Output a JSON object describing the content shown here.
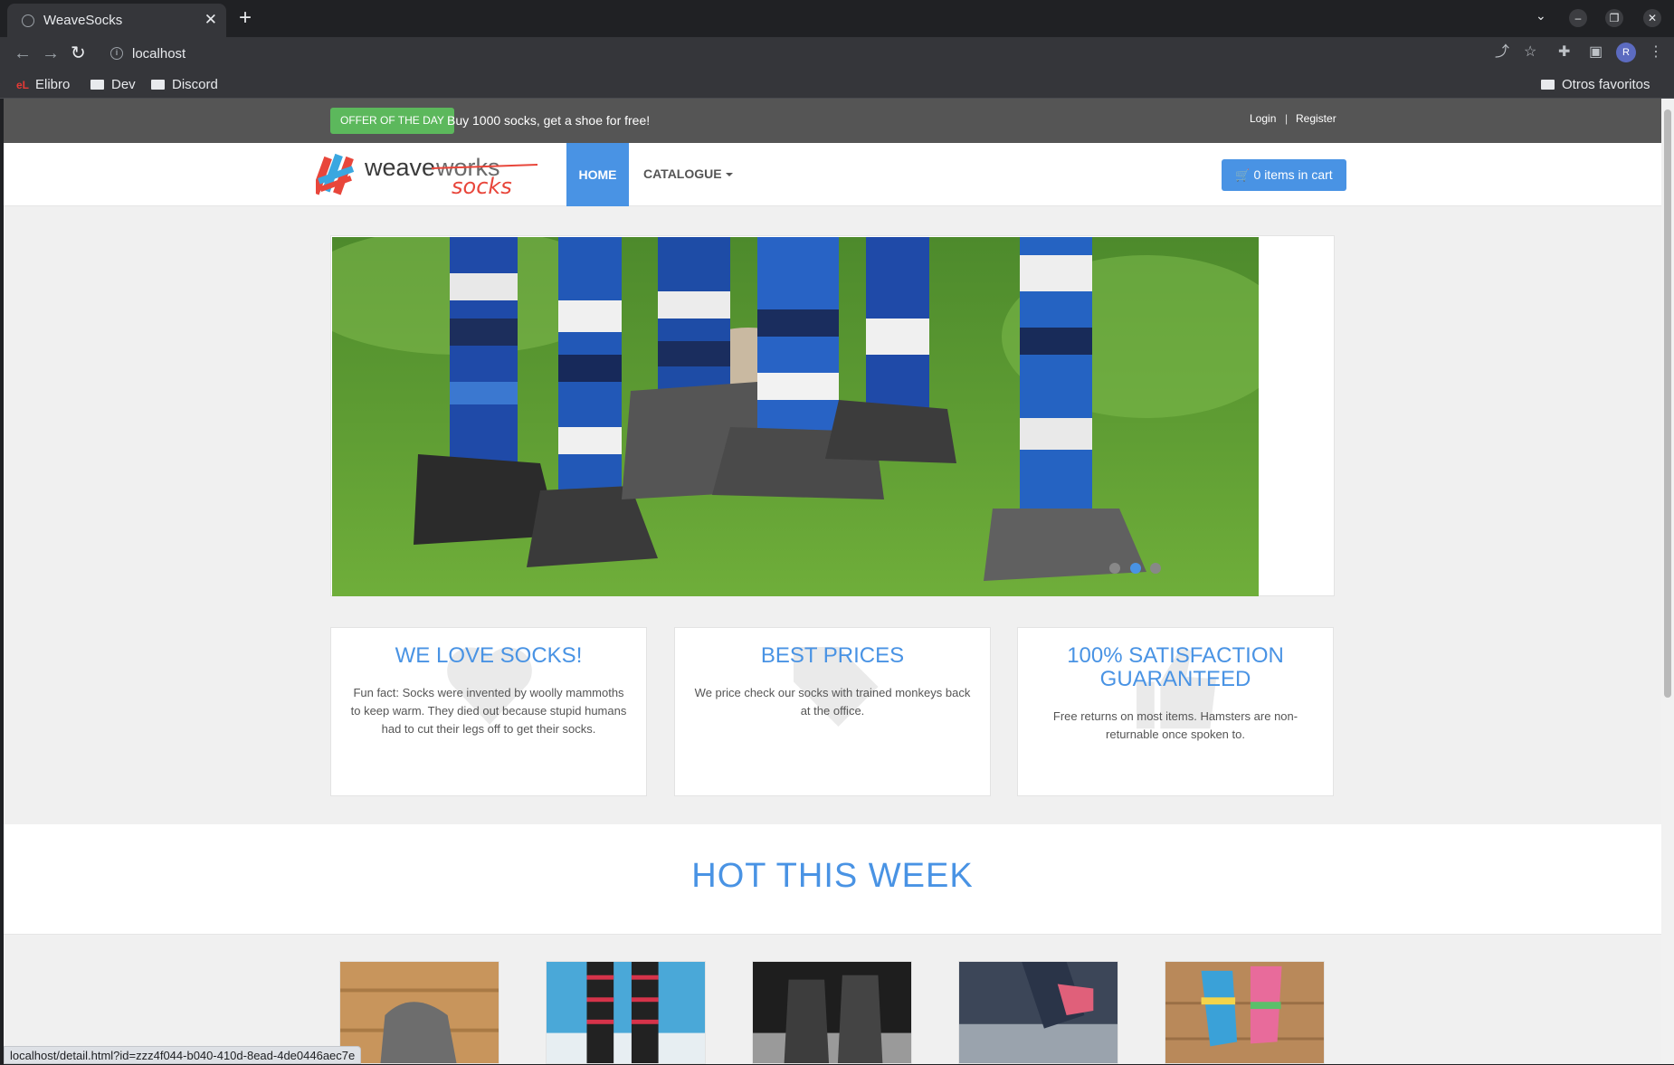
{
  "browser": {
    "tab_title": "WeaveSocks",
    "url": "localhost",
    "profile_initial": "R",
    "bookmarks": [
      "Elibro",
      "Dev",
      "Discord"
    ],
    "other_bookmarks": "Otros favoritos",
    "status_url": "localhost/detail.html?id=zzz4f044-b040-410d-8ead-4de0446aec7e"
  },
  "topbar": {
    "offer_badge": "OFFER OF THE DAY",
    "offer_text": "Buy 1000 socks, get a shoe for free!",
    "login": "Login",
    "separator": "|",
    "register": "Register"
  },
  "navbar": {
    "logo_word1": "weave",
    "logo_word2": "works",
    "logo_word3": "socks",
    "home": "HOME",
    "catalogue": "CATALOGUE",
    "cart_label": "0 items in cart"
  },
  "carousel": {
    "slide_count": 3,
    "active_slide": 2
  },
  "features": [
    {
      "title": "WE LOVE SOCKS!",
      "text": "Fun fact: Socks were invented by woolly mammoths to keep warm. They died out because stupid humans had to cut their legs off to get their socks."
    },
    {
      "title": "BEST PRICES",
      "text": "We price check our socks with trained monkeys back at the office."
    },
    {
      "title_line1": "100% SATISFACTION",
      "title_line2": "GUARANTEED",
      "text": "Free returns on most items. Hamsters are non-returnable once spoken to."
    }
  ],
  "hot": {
    "title": "HOT THIS WEEK"
  },
  "colors": {
    "accent": "#4993e4",
    "offer_green": "#5cb85c",
    "topbar": "#555555"
  }
}
